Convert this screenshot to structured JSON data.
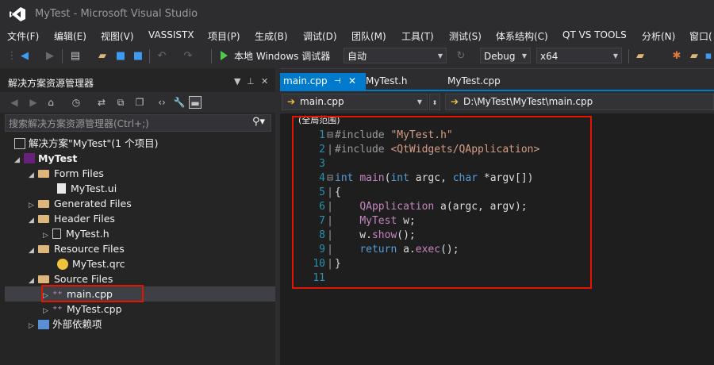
{
  "window": {
    "title": "MyTest - Microsoft Visual Studio"
  },
  "menu": [
    "文件(F)",
    "编辑(E)",
    "视图(V)",
    "VASSISTX",
    "项目(P)",
    "生成(B)",
    "调试(D)",
    "团队(M)",
    "工具(T)",
    "测试(S)",
    "体系结构(C)",
    "QT VS TOOLS",
    "分析(N)",
    "窗口("
  ],
  "toolbar": {
    "run_label": "本地 Windows 调试器",
    "run_mode": "自动",
    "configuration": "Debug",
    "platform": "x64"
  },
  "solution_explorer": {
    "title": "解决方案资源管理器",
    "search_placeholder": "搜索解决方案资源管理器(Ctrl+;)",
    "items": [
      {
        "label": "解决方案\"MyTest\"(1 个项目)",
        "kind": "solution"
      },
      {
        "label": "MyTest",
        "kind": "project"
      },
      {
        "label": "Form Files",
        "kind": "folder"
      },
      {
        "label": "MyTest.ui",
        "kind": "ui"
      },
      {
        "label": "Generated Files",
        "kind": "folder"
      },
      {
        "label": "Header Files",
        "kind": "folder"
      },
      {
        "label": "MyTest.h",
        "kind": "header"
      },
      {
        "label": "Resource Files",
        "kind": "folder"
      },
      {
        "label": "MyTest.qrc",
        "kind": "qrc"
      },
      {
        "label": "Source Files",
        "kind": "folder"
      },
      {
        "label": "main.cpp",
        "kind": "cpp"
      },
      {
        "label": "MyTest.cpp",
        "kind": "cpp"
      },
      {
        "label": "外部依赖项",
        "kind": "external"
      }
    ]
  },
  "editor": {
    "tabs": [
      {
        "label": "main.cpp",
        "active": true
      },
      {
        "label": "MyTest.h",
        "active": false
      },
      {
        "label": "MyTest.cpp",
        "active": false
      }
    ],
    "nav_file": "main.cpp",
    "nav_path": "D:\\MyTest\\MyTest\\main.cpp",
    "scope": "(全局范围)",
    "line_numbers": [
      "1",
      "2",
      "3",
      "4",
      "5",
      "6",
      "7",
      "8",
      "9",
      "10",
      "11"
    ],
    "code": [
      "#include \"MyTest.h\"",
      "#include <QtWidgets/QApplication>",
      "",
      "int main(int argc, char *argv[])",
      "{",
      "    QApplication a(argc, argv);",
      "    MyTest w;",
      "    w.show();",
      "    return a.exec();",
      "}",
      ""
    ]
  },
  "colors": {
    "accent": "#007acc",
    "highlight_box": "#e51400"
  }
}
